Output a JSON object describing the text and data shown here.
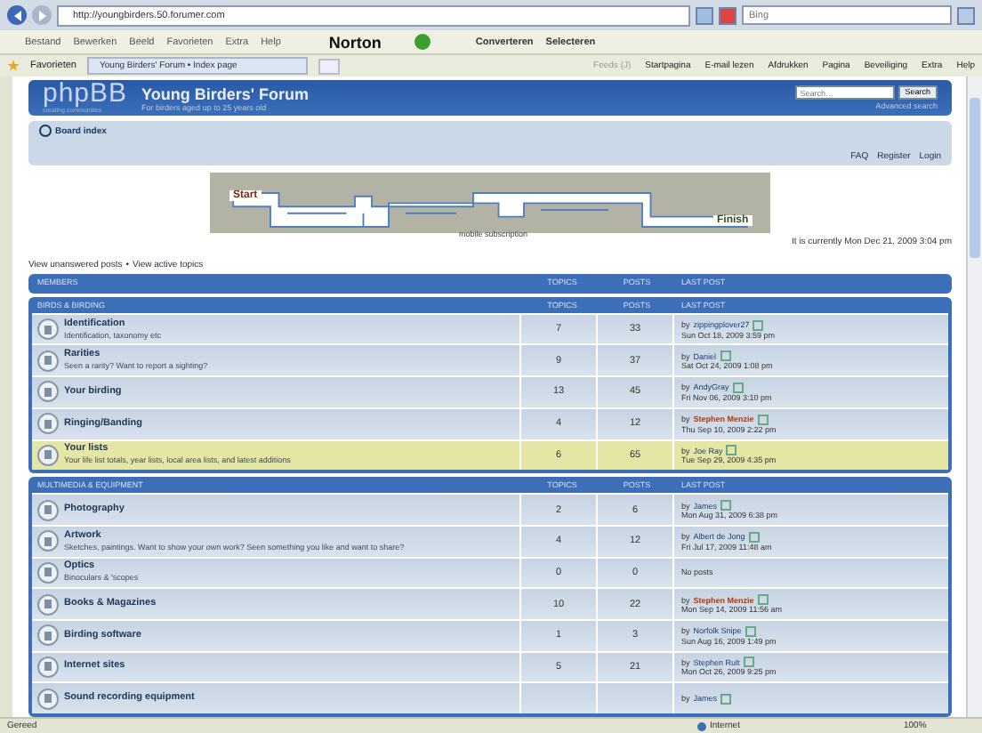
{
  "browser": {
    "url": "http://youngbirders.50.forumer.com",
    "search_placeholder": "Bing",
    "menu": [
      "Bestand",
      "Bewerken",
      "Beeld",
      "Favorieten",
      "Extra",
      "Help"
    ],
    "norton": "Norton",
    "addons": [
      "Converteren",
      "Selecteren"
    ],
    "favorites": "Favorieten",
    "tab": "Young Birders' Forum • Index page",
    "commands": [
      {
        "label": "Feeds (J)",
        "disabled": true
      },
      {
        "label": "Startpagina",
        "disabled": false
      },
      {
        "label": "E-mail lezen",
        "disabled": false
      },
      {
        "label": "Afdrukken",
        "disabled": false
      },
      {
        "label": "Pagina",
        "disabled": false
      },
      {
        "label": "Beveiliging",
        "disabled": false
      },
      {
        "label": "Extra",
        "disabled": false
      },
      {
        "label": "Help",
        "disabled": false
      }
    ]
  },
  "forum": {
    "logo": "phpBB",
    "logo_tagline": "creating communities",
    "title": "Young Birders' Forum",
    "subtitle": "For birders aged up to 25 years old",
    "search_placeholder": "Search…",
    "search_button": "Search",
    "advanced_search": "Advanced search",
    "breadcrumb": "Board index",
    "user_links": [
      "FAQ",
      "Register",
      "Login"
    ],
    "banner": {
      "start": "Start",
      "finish": "Finish",
      "caption": "mobile subscription"
    },
    "current_time": "It is currently Mon Dec 21, 2009 3:04 pm",
    "quick_links": [
      "View unanswered posts",
      "View active topics"
    ],
    "quick_links_separator": "•",
    "categories": [
      {
        "name": "MEMBERS",
        "columns": [
          "TOPICS",
          "POSTS",
          "LAST POST"
        ]
      },
      {
        "name": "BIRDS & BIRDING",
        "columns": [
          "TOPICS",
          "POSTS",
          "LAST POST"
        ],
        "forums": [
          {
            "title": "Identification",
            "description": "Identification, taxonomy etc",
            "topics": "7",
            "posts": "33",
            "highlighted": false,
            "last_post": {
              "kind": "post",
              "by": "by",
              "author": "zippingplover27",
              "moderator": false,
              "time": "Sun Oct 18, 2009 3:59 pm"
            }
          },
          {
            "title": "Rarities",
            "description": "Seen a rarity? Want to report a sighting?",
            "topics": "9",
            "posts": "37",
            "highlighted": false,
            "last_post": {
              "kind": "post",
              "by": "by",
              "author": "Daniel",
              "moderator": false,
              "time": "Sat Oct 24, 2009 1:08 pm"
            }
          },
          {
            "title": "Your birding",
            "topics": "13",
            "posts": "45",
            "highlighted": false,
            "last_post": {
              "kind": "post",
              "by": "by",
              "author": "AndyGray",
              "moderator": false,
              "time": "Fri Nov 06, 2009 3:10 pm"
            }
          },
          {
            "title": "Ringing/Banding",
            "topics": "4",
            "posts": "12",
            "highlighted": false,
            "last_post": {
              "kind": "post",
              "by": "by",
              "author": "Stephen Menzie",
              "moderator": true,
              "time": "Thu Sep 10, 2009 2:22 pm"
            }
          },
          {
            "title": "Your lists",
            "description": "Your life list totals, year lists, local area lists, and latest additions",
            "topics": "6",
            "posts": "65",
            "highlighted": true,
            "last_post": {
              "kind": "post",
              "by": "by",
              "author": "Joe Ray",
              "moderator": false,
              "time": "Tue Sep 29, 2009 4:35 pm"
            }
          }
        ]
      },
      {
        "name": "MULTIMEDIA & EQUIPMENT",
        "columns": [
          "TOPICS",
          "POSTS",
          "LAST POST"
        ],
        "forums": [
          {
            "title": "Photography",
            "topics": "2",
            "posts": "6",
            "highlighted": false,
            "last_post": {
              "kind": "post",
              "by": "by",
              "author": "James",
              "moderator": false,
              "time": "Mon Aug 31, 2009 6:38 pm"
            }
          },
          {
            "title": "Artwork",
            "description": "Sketches, paintings. Want to show your own work? Seen something you like and want to share?",
            "topics": "4",
            "posts": "12",
            "highlighted": false,
            "last_post": {
              "kind": "post",
              "by": "by",
              "author": "Albert de Jong",
              "moderator": false,
              "time": "Fri Jul 17, 2009 11:48 am"
            }
          },
          {
            "title": "Optics",
            "description": "Binoculars & 'scopes",
            "topics": "0",
            "posts": "0",
            "highlighted": false,
            "last_post": {
              "kind": "empty",
              "text": "No posts"
            }
          },
          {
            "title": "Books & Magazines",
            "topics": "10",
            "posts": "22",
            "highlighted": false,
            "last_post": {
              "kind": "post",
              "by": "by",
              "author": "Stephen Menzie",
              "moderator": true,
              "time": "Mon Sep 14, 2009 11:56 am"
            }
          },
          {
            "title": "Birding software",
            "topics": "1",
            "posts": "3",
            "highlighted": false,
            "last_post": {
              "kind": "post",
              "by": "by",
              "author": "Norfolk Snipe",
              "moderator": false,
              "time": "Sun Aug 16, 2009 1:49 pm"
            }
          },
          {
            "title": "Internet sites",
            "topics": "5",
            "posts": "21",
            "highlighted": false,
            "last_post": {
              "kind": "post",
              "by": "by",
              "author": "Stephen Rult",
              "moderator": false,
              "time": "Mon Oct 26, 2009 9:25 pm"
            }
          },
          {
            "title": "Sound recording equipment",
            "highlighted": false,
            "last_post": {
              "kind": "post",
              "by": "by",
              "author": "James",
              "moderator": false
            }
          }
        ]
      }
    ]
  },
  "status_bar": {
    "text": "Gereed",
    "zone": "Internet",
    "zoom": "100%"
  }
}
